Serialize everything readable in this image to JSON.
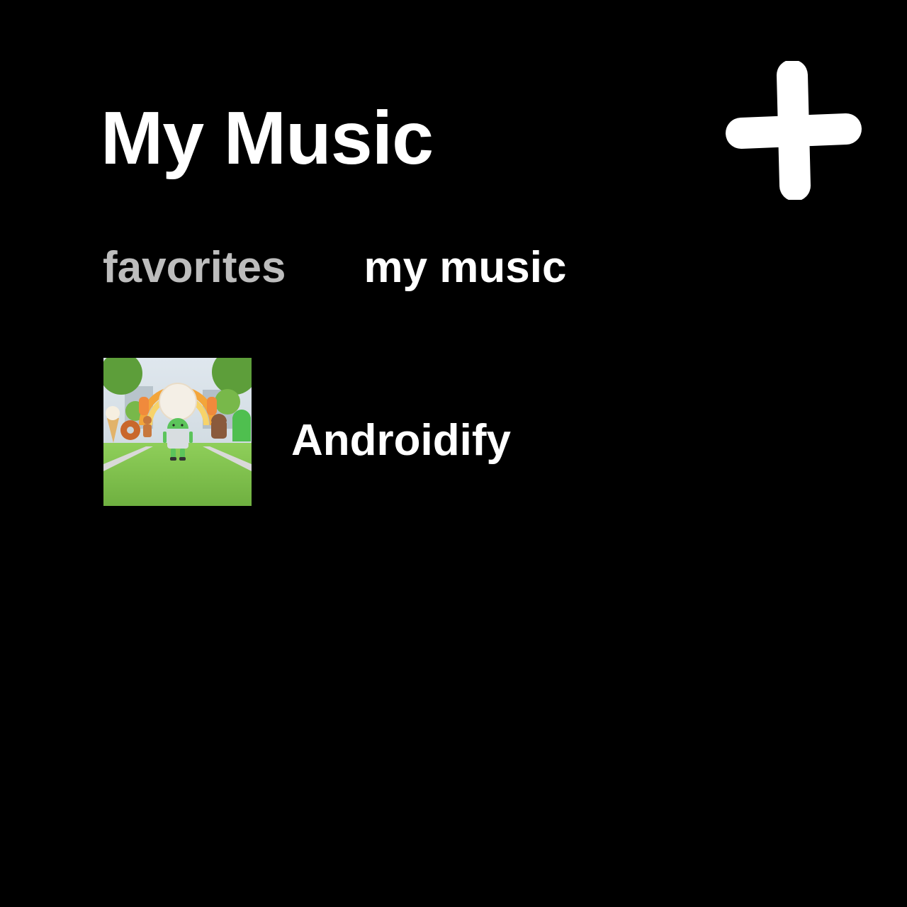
{
  "header": {
    "title": "My Music",
    "add_icon": "plus-icon"
  },
  "tabs": [
    {
      "label": "favorites",
      "selected": false
    },
    {
      "label": "my music",
      "selected": true
    }
  ],
  "list": {
    "items": [
      {
        "title": "Androidify",
        "artwork_icon": "androidify-album-art"
      }
    ]
  },
  "colors": {
    "background": "#000000",
    "text_primary": "#ffffff",
    "text_inactive": "#bdbdbd"
  }
}
